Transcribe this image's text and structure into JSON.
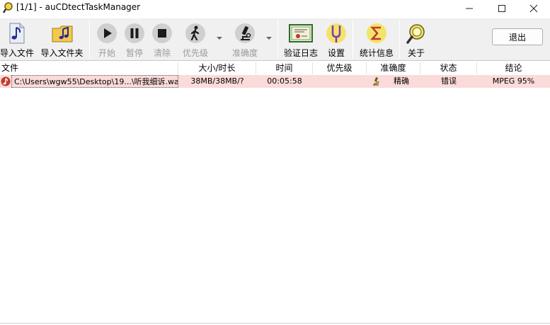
{
  "window": {
    "title": "[1/1] - auCDtectTaskManager",
    "minimize_glyph": "—",
    "maximize_glyph": "☐",
    "close_glyph": "✕"
  },
  "toolbar": {
    "import_file": "导入文件",
    "import_folder": "导入文件夹",
    "start": "开始",
    "pause": "暂停",
    "clear": "清除",
    "priority": "优先级",
    "accuracy": "准确度",
    "verify_log": "验证日志",
    "settings": "设置",
    "statistics": "统计信息",
    "about": "关于",
    "exit": "退出"
  },
  "table": {
    "columns": [
      "文件",
      "大小/时长",
      "时间",
      "优先级",
      "准确度",
      "状态",
      "结论"
    ],
    "rows": [
      {
        "file": "C:\\Users\\wgw55\\Desktop\\19...\\听我细诉.wav",
        "size": "38MB/38MB/?",
        "time": "00:05:58",
        "priority": "",
        "accuracy": "精确",
        "status": "错误",
        "conclusion": "MPEG 95%"
      }
    ]
  },
  "icons": {
    "app": "magnifier-icon",
    "import_file": "music-note-file-icon",
    "import_folder": "music-folder-icon",
    "start": "play-icon",
    "pause": "pause-icon",
    "clear": "stop-icon",
    "priority": "walking-man-icon",
    "accuracy": "microscope-icon",
    "verify_log": "certificate-icon",
    "settings": "tuning-fork-icon",
    "statistics": "sigma-icon",
    "about": "magnifier-icon"
  },
  "colors": {
    "row_error_bg": "#fbdada",
    "toolbar_bg": "#f0f0f0"
  }
}
